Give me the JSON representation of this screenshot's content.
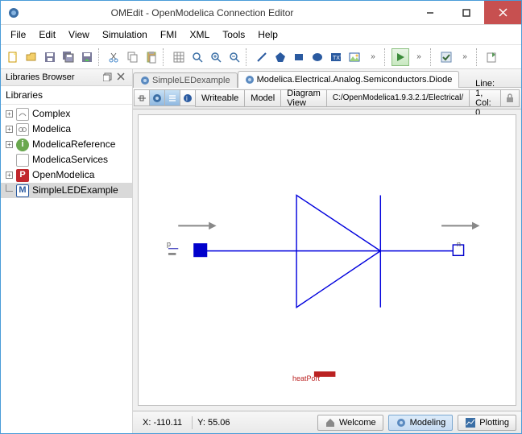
{
  "window": {
    "title": "OMEdit - OpenModelica Connection Editor"
  },
  "menu": {
    "items": [
      "File",
      "Edit",
      "View",
      "Simulation",
      "FMI",
      "XML",
      "Tools",
      "Help"
    ]
  },
  "sidebar": {
    "title": "Libraries Browser",
    "label": "Libraries",
    "items": [
      {
        "name": "Complex"
      },
      {
        "name": "Modelica"
      },
      {
        "name": "ModelicaReference"
      },
      {
        "name": "ModelicaServices"
      },
      {
        "name": "OpenModelica"
      },
      {
        "name": "SimpleLEDExample"
      }
    ]
  },
  "tabs": [
    {
      "label": "SimpleLEDexample"
    },
    {
      "label": "Modelica.Electrical.Analog.Semiconductors.Diode"
    }
  ],
  "subbar": {
    "writeable": "Writeable",
    "model": "Model",
    "view": "Diagram View",
    "path": "C:/OpenModelica1.9.3.2.1/Electrical/",
    "linecol": "Line: 1, Col: 0"
  },
  "diagram": {
    "portP": "p",
    "portN": "n",
    "heatPort": "heatPort"
  },
  "status": {
    "x": "X: -110.11",
    "y": "Y: 55.06",
    "welcome": "Welcome",
    "modeling": "Modeling",
    "plotting": "Plotting"
  }
}
